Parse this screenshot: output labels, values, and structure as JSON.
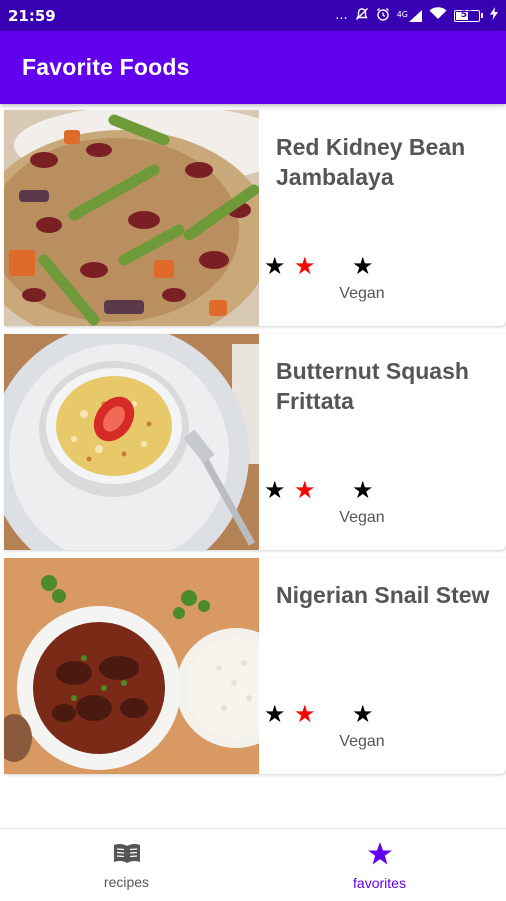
{
  "status_bar": {
    "time": "21:59",
    "more": "...",
    "network": "4G",
    "battery_level": "53",
    "battery_fraction": 0.53
  },
  "app_bar": {
    "title": "Favorite Foods"
  },
  "colors": {
    "status_bar": "#3700B3",
    "app_bar": "#6200EE",
    "star_filled": "#000000",
    "star_red": "#FF0000",
    "nav_active": "#6200EE",
    "nav_inactive": "#555555"
  },
  "foods": [
    {
      "name": "Red Kidney Bean Jambalaya",
      "diet": "Vegan",
      "star_glyph": "★"
    },
    {
      "name": "Butternut Squash Frittata",
      "diet": "Vegan",
      "star_glyph": "★"
    },
    {
      "name": "Nigerian Snail Stew",
      "diet": "Vegan",
      "star_glyph": "★"
    }
  ],
  "bottom_nav": {
    "items": [
      {
        "label": "recipes",
        "icon": "book-icon",
        "active": false
      },
      {
        "label": "favorites",
        "icon": "star-icon",
        "active": true
      }
    ]
  }
}
